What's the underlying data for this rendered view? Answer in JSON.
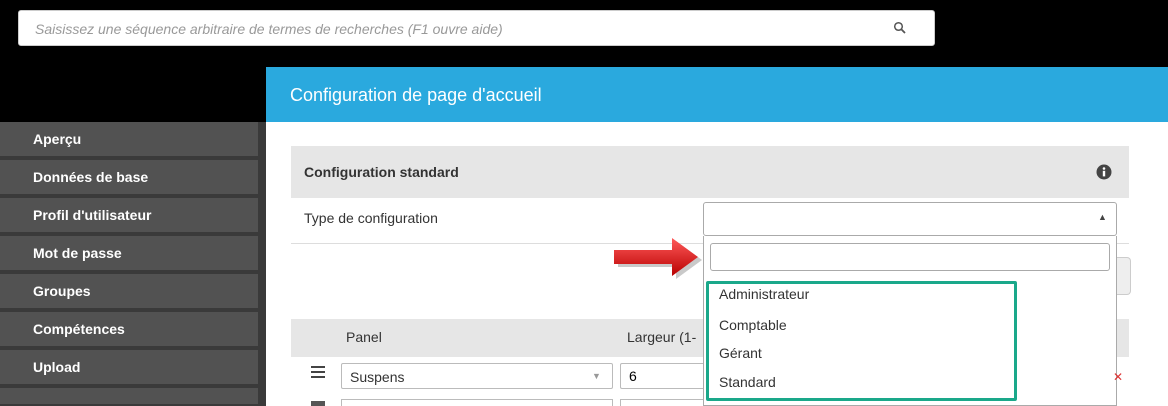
{
  "search": {
    "placeholder": "Saisissez une séquence arbitraire de termes de recherches (F1 ouvre aide)",
    "icon": "search-icon"
  },
  "sidebar": {
    "items": [
      {
        "label": "Aperçu"
      },
      {
        "label": "Données de base"
      },
      {
        "label": "Profil d'utilisateur"
      },
      {
        "label": "Mot de passe"
      },
      {
        "label": "Groupes"
      },
      {
        "label": "Compétences"
      },
      {
        "label": "Upload"
      }
    ]
  },
  "header": {
    "title": "Configuration de page d'accueil",
    "color": "#2aa9de"
  },
  "config": {
    "section_title": "Configuration standard",
    "info_icon": "info-icon",
    "type_label": "Type de configuration",
    "selected_value": "",
    "dropdown": {
      "search_value": "",
      "options": [
        "Administrateur",
        "Comptable",
        "Gérant",
        "Standard"
      ],
      "highlight_color": "#1aa88a"
    }
  },
  "annotation": {
    "arrow_color": "#e01b1b"
  },
  "table": {
    "columns": [
      "Panel",
      "Largeur (1-"
    ],
    "rows": [
      {
        "panel": "Suspens",
        "width": "6"
      }
    ]
  }
}
